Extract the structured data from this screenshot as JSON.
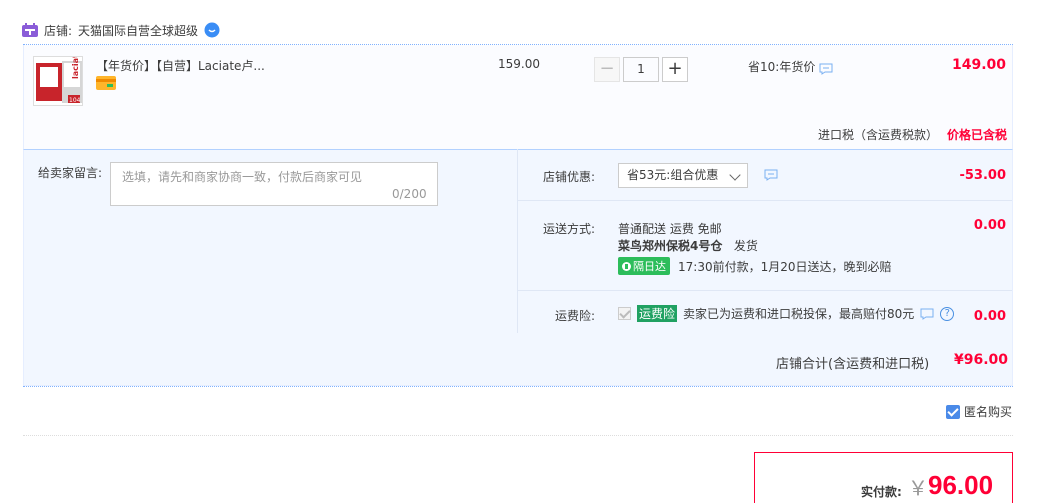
{
  "shop": {
    "label": "店铺:",
    "name": "天猫国际自营全球超级"
  },
  "item": {
    "title": "【年货价】【自营】Laciate卢...",
    "unit_price": "159.00",
    "quantity": "1",
    "qty_minus": "−",
    "qty_plus": "+",
    "promo": "省10:年货价",
    "line_total": "149.00",
    "tax_label": "进口税（含运费税款）",
    "tax_value": "价格已含税"
  },
  "memo": {
    "label": "给卖家留言:",
    "placeholder": "选填，请先和商家协商一致，付款后商家可见",
    "count": "0/200"
  },
  "discount": {
    "label": "店铺优惠:",
    "selected": "省53元:组合优惠",
    "value": "-53.00"
  },
  "shipping": {
    "label": "运送方式:",
    "method": "普通配送 运费 免邮",
    "warehouse": "菜鸟郑州保税4号仓",
    "dispatch": "发货",
    "badge": "隔日达",
    "eta": "17:30前付款，1月20日送达，晚到必赔",
    "value": "0.00"
  },
  "insurance": {
    "label": "运费险:",
    "badge": "运费险",
    "text": "卖家已为运费和进口税投保，最高赔付80元",
    "help": "?",
    "value": "0.00"
  },
  "shop_total": {
    "label": "店铺合计(含运费和进口税)",
    "value": "¥96.00"
  },
  "anonymous": {
    "label": "匿名购买"
  },
  "payment": {
    "label": "实付款:",
    "currency": "￥",
    "amount": "96.00"
  },
  "thumb_text": {
    "brand": "laciate",
    "badge": "104"
  },
  "colors": {
    "accent": "#ff0036",
    "blue": "#4a8ae8",
    "panel": "#f2f7ff"
  }
}
